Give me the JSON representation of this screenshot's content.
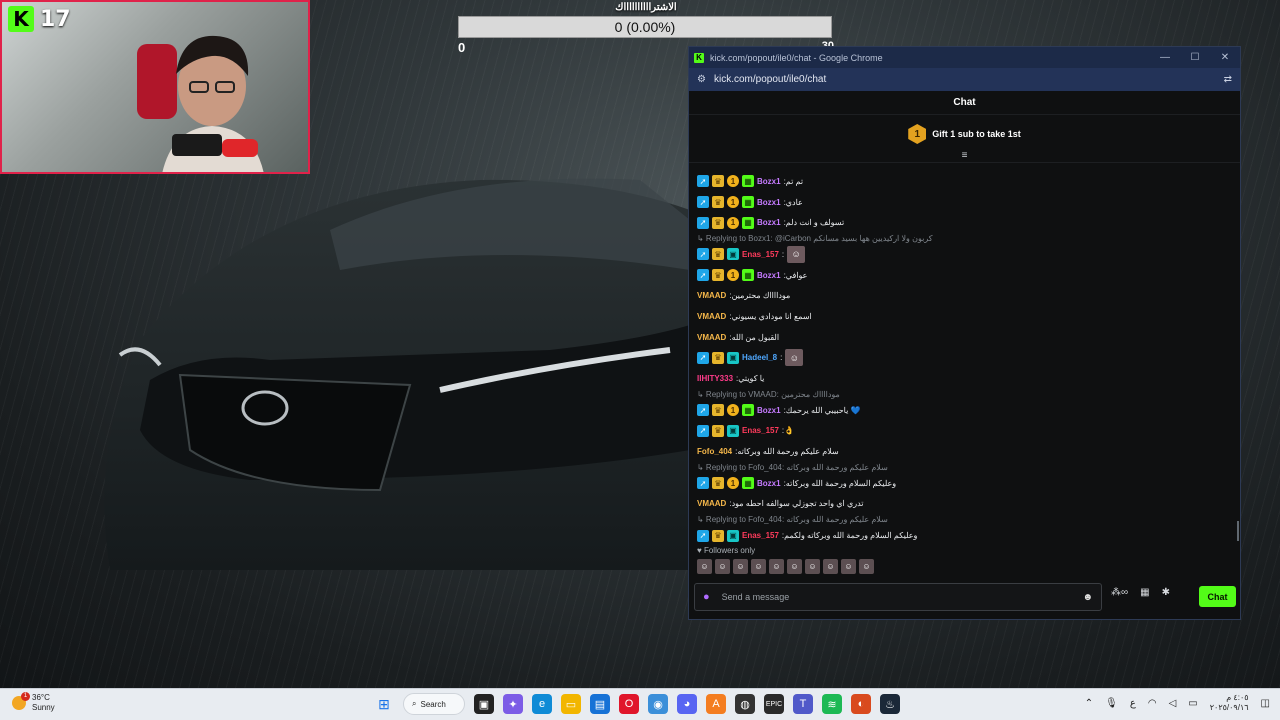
{
  "stream": {
    "viewer_count": "17"
  },
  "poll": {
    "title": "الاشترااااااااااك",
    "progress_text": "0 (0.00%)",
    "progress": 0,
    "min": "0",
    "max": "30"
  },
  "browser": {
    "window_title": "kick.com/popout/ile0/chat - Google Chrome",
    "url": "kick.com/popout/ile0/chat",
    "controls": {
      "minimize": "—",
      "maximize": "☐",
      "close": "✕"
    }
  },
  "chat": {
    "header": "Chat",
    "gift_rank": "1",
    "gift_text": "Gift 1 sub to take 1st",
    "collapse_icon": "≡",
    "followers_only": "♥ Followers only",
    "composer_placeholder": "Send a message",
    "send_label": "Chat",
    "entries": [
      {
        "type": "msg",
        "badges": [
          "mod",
          "crown",
          "coin",
          "sub"
        ],
        "user": "Bozx1",
        "color": "#c57bff",
        "text": "تم تم"
      },
      {
        "type": "msg",
        "badges": [
          "mod",
          "crown",
          "coin",
          "sub"
        ],
        "user": "Bozx1",
        "color": "#c57bff",
        "text": "عادي"
      },
      {
        "type": "msg",
        "badges": [
          "mod",
          "crown",
          "coin",
          "sub"
        ],
        "user": "Bozx1",
        "color": "#c57bff",
        "text": "تسولف و انت دلم"
      },
      {
        "type": "reply",
        "text": "↳ Replying to Bozx1: @iCarbon كربون ولا اركيديين هها بسيد مسانكم"
      },
      {
        "type": "msg",
        "badges": [
          "mod",
          "crown",
          "og"
        ],
        "user": "Enas_157",
        "color": "#ff3b5c",
        "text": "",
        "emote": true
      },
      {
        "type": "msg",
        "badges": [
          "mod",
          "crown",
          "coin",
          "sub"
        ],
        "user": "Bozx1",
        "color": "#c57bff",
        "text": "عوافي"
      },
      {
        "type": "msg",
        "badges": [],
        "user": "VMAAD",
        "color": "#f5b74a",
        "text": "مودااااك محترمين"
      },
      {
        "type": "msg",
        "badges": [],
        "user": "VMAAD",
        "color": "#f5b74a",
        "text": "اسمع انا مودادي يسيوني"
      },
      {
        "type": "msg",
        "badges": [],
        "user": "VMAAD",
        "color": "#f5b74a",
        "text": "القبول من الله"
      },
      {
        "type": "msg",
        "badges": [
          "mod",
          "crown",
          "og"
        ],
        "user": "Hadeel_8",
        "color": "#4fa8ff",
        "text": "",
        "emote": true
      },
      {
        "type": "msg",
        "badges": [],
        "user": "IIHITY333",
        "color": "#ff3b8a",
        "text": "يا كويتي"
      },
      {
        "type": "reply",
        "text": "↳ Replying to VMAAD: مودااااك محترمين"
      },
      {
        "type": "msg",
        "badges": [
          "mod",
          "crown",
          "coin",
          "sub"
        ],
        "user": "Bozx1",
        "color": "#c57bff",
        "text": "ياحبيبي الله يرحمك 💙"
      },
      {
        "type": "msg",
        "badges": [
          "mod",
          "crown",
          "og"
        ],
        "user": "Enas_157",
        "color": "#ff3b5c",
        "text": "👌"
      },
      {
        "type": "msg",
        "badges": [],
        "user": "Fofo_404",
        "color": "#f5b74a",
        "text": "سلام عليكم ورحمة الله وبركاته"
      },
      {
        "type": "reply",
        "text": "↳ Replying to Fofo_404: سلام عليكم ورحمة الله وبركاته"
      },
      {
        "type": "msg",
        "badges": [
          "mod",
          "crown",
          "coin",
          "sub"
        ],
        "user": "Bozx1",
        "color": "#c57bff",
        "text": "وعليكم السلام ورحمة الله وبركاته"
      },
      {
        "type": "msg",
        "badges": [],
        "user": "VMAAD",
        "color": "#f5b74a",
        "text": "تدري اي واحد تجوزلي سوالفه احطه مود"
      },
      {
        "type": "reply",
        "text": "↳ Replying to Fofo_404: سلام عليكم ورحمة الله وبركاته"
      },
      {
        "type": "msg",
        "badges": [
          "mod",
          "crown",
          "og"
        ],
        "user": "Enas_157",
        "color": "#ff3b5c",
        "text": "وعليكم السلام ورحمة الله وبركاته ولكمم"
      }
    ]
  },
  "taskbar": {
    "weather_temp": "36°C",
    "weather_desc": "Sunny",
    "weather_alert": "1",
    "search_label": "Search",
    "lang": "ع",
    "time": "٤:٠٥ م",
    "date": "٢٠٢٥/٠٩/١٦"
  }
}
